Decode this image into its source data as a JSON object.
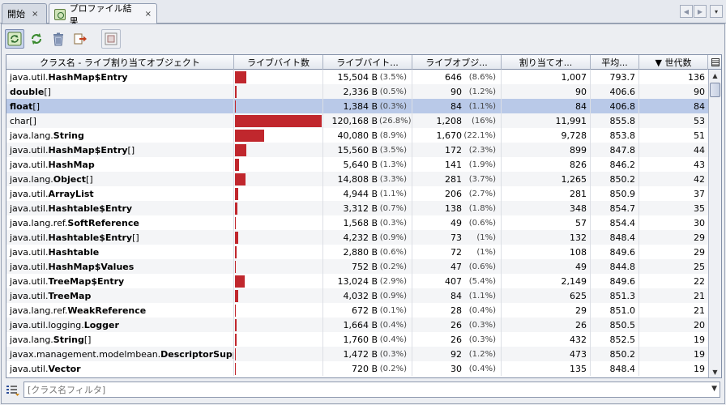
{
  "tabs": [
    {
      "label": "開始",
      "close": "×"
    },
    {
      "label": "プロファイル結果",
      "close": "×"
    }
  ],
  "nav": {
    "left": "◀",
    "right": "▶",
    "menu": "▾"
  },
  "table": {
    "headers": [
      "クラス名 - ライブ割り当てオブジェクト",
      "ライブバイト数",
      "ライブバイト...",
      "ライブオブジ...",
      "割り当てオ...",
      "平均...",
      "▼ 世代数"
    ],
    "rows": [
      {
        "pkg": "java.util.",
        "cls": "HashMap$Entry",
        "suffix": "",
        "bar": 3.5,
        "bytes": "15,504 B",
        "bpct": "(3.5%)",
        "objs": "646",
        "opct": "(8.6%)",
        "alloc": "1,007",
        "avg": "793.7",
        "gen": "136"
      },
      {
        "pkg": "",
        "cls": "double",
        "suffix": "[]",
        "bar": 0.5,
        "bytes": "2,336 B",
        "bpct": "(0.5%)",
        "objs": "90",
        "opct": "(1.2%)",
        "alloc": "90",
        "avg": "406.6",
        "gen": "90"
      },
      {
        "pkg": "",
        "cls": "float",
        "suffix": "[]",
        "bar": 0.3,
        "bytes": "1,384 B",
        "bpct": "(0.3%)",
        "objs": "84",
        "opct": "(1.1%)",
        "alloc": "84",
        "avg": "406.8",
        "gen": "84"
      },
      {
        "pkg": "",
        "cls": "",
        "suffix": "char[]",
        "bar": 26.8,
        "bytes": "120,168 B",
        "bpct": "(26.8%)",
        "objs": "1,208",
        "opct": "(16%)",
        "alloc": "11,991",
        "avg": "855.8",
        "gen": "53"
      },
      {
        "pkg": "java.lang.",
        "cls": "String",
        "suffix": "",
        "bar": 8.9,
        "bytes": "40,080 B",
        "bpct": "(8.9%)",
        "objs": "1,670",
        "opct": "(22.1%)",
        "alloc": "9,728",
        "avg": "853.8",
        "gen": "51"
      },
      {
        "pkg": "java.util.",
        "cls": "HashMap$Entry",
        "suffix": "[]",
        "bar": 3.5,
        "bytes": "15,560 B",
        "bpct": "(3.5%)",
        "objs": "172",
        "opct": "(2.3%)",
        "alloc": "899",
        "avg": "847.8",
        "gen": "44"
      },
      {
        "pkg": "java.util.",
        "cls": "HashMap",
        "suffix": "",
        "bar": 1.3,
        "bytes": "5,640 B",
        "bpct": "(1.3%)",
        "objs": "141",
        "opct": "(1.9%)",
        "alloc": "826",
        "avg": "846.2",
        "gen": "43"
      },
      {
        "pkg": "java.lang.",
        "cls": "Object",
        "suffix": "[]",
        "bar": 3.3,
        "bytes": "14,808 B",
        "bpct": "(3.3%)",
        "objs": "281",
        "opct": "(3.7%)",
        "alloc": "1,265",
        "avg": "850.2",
        "gen": "42"
      },
      {
        "pkg": "java.util.",
        "cls": "ArrayList",
        "suffix": "",
        "bar": 1.1,
        "bytes": "4,944 B",
        "bpct": "(1.1%)",
        "objs": "206",
        "opct": "(2.7%)",
        "alloc": "281",
        "avg": "850.9",
        "gen": "37"
      },
      {
        "pkg": "java.util.",
        "cls": "Hashtable$Entry",
        "suffix": "",
        "bar": 0.7,
        "bytes": "3,312 B",
        "bpct": "(0.7%)",
        "objs": "138",
        "opct": "(1.8%)",
        "alloc": "348",
        "avg": "854.7",
        "gen": "35"
      },
      {
        "pkg": "java.lang.ref.",
        "cls": "SoftReference",
        "suffix": "",
        "bar": 0.3,
        "bytes": "1,568 B",
        "bpct": "(0.3%)",
        "objs": "49",
        "opct": "(0.6%)",
        "alloc": "57",
        "avg": "854.4",
        "gen": "30"
      },
      {
        "pkg": "java.util.",
        "cls": "Hashtable$Entry",
        "suffix": "[]",
        "bar": 0.9,
        "bytes": "4,232 B",
        "bpct": "(0.9%)",
        "objs": "73",
        "opct": "(1%)",
        "alloc": "132",
        "avg": "848.4",
        "gen": "29"
      },
      {
        "pkg": "java.util.",
        "cls": "Hashtable",
        "suffix": "",
        "bar": 0.6,
        "bytes": "2,880 B",
        "bpct": "(0.6%)",
        "objs": "72",
        "opct": "(1%)",
        "alloc": "108",
        "avg": "849.6",
        "gen": "29"
      },
      {
        "pkg": "java.util.",
        "cls": "HashMap$Values",
        "suffix": "",
        "bar": 0.2,
        "bytes": "752 B",
        "bpct": "(0.2%)",
        "objs": "47",
        "opct": "(0.6%)",
        "alloc": "49",
        "avg": "844.8",
        "gen": "25"
      },
      {
        "pkg": "java.util.",
        "cls": "TreeMap$Entry",
        "suffix": "",
        "bar": 2.9,
        "bytes": "13,024 B",
        "bpct": "(2.9%)",
        "objs": "407",
        "opct": "(5.4%)",
        "alloc": "2,149",
        "avg": "849.6",
        "gen": "22"
      },
      {
        "pkg": "java.util.",
        "cls": "TreeMap",
        "suffix": "",
        "bar": 0.9,
        "bytes": "4,032 B",
        "bpct": "(0.9%)",
        "objs": "84",
        "opct": "(1.1%)",
        "alloc": "625",
        "avg": "851.3",
        "gen": "21"
      },
      {
        "pkg": "java.lang.ref.",
        "cls": "WeakReference",
        "suffix": "",
        "bar": 0.1,
        "bytes": "672 B",
        "bpct": "(0.1%)",
        "objs": "28",
        "opct": "(0.4%)",
        "alloc": "29",
        "avg": "851.0",
        "gen": "21"
      },
      {
        "pkg": "java.util.logging.",
        "cls": "Logger",
        "suffix": "",
        "bar": 0.4,
        "bytes": "1,664 B",
        "bpct": "(0.4%)",
        "objs": "26",
        "opct": "(0.3%)",
        "alloc": "26",
        "avg": "850.5",
        "gen": "20"
      },
      {
        "pkg": "java.lang.",
        "cls": "String",
        "suffix": "[]",
        "bar": 0.4,
        "bytes": "1,760 B",
        "bpct": "(0.4%)",
        "objs": "26",
        "opct": "(0.3%)",
        "alloc": "432",
        "avg": "852.5",
        "gen": "19"
      },
      {
        "pkg": "javax.management.modelmbean.",
        "cls": "DescriptorSupp...",
        "suffix": "",
        "bar": 0.3,
        "bytes": "1,472 B",
        "bpct": "(0.3%)",
        "objs": "92",
        "opct": "(1.2%)",
        "alloc": "473",
        "avg": "850.2",
        "gen": "19"
      },
      {
        "pkg": "java.util.",
        "cls": "Vector",
        "suffix": "",
        "bar": 0.2,
        "bytes": "720 B",
        "bpct": "(0.2%)",
        "objs": "30",
        "opct": "(0.4%)",
        "alloc": "135",
        "avg": "848.4",
        "gen": "19"
      }
    ],
    "selected_row": 2,
    "bar_color": "#c0272d"
  },
  "filter": {
    "placeholder": "[クラス名フィルタ]"
  }
}
